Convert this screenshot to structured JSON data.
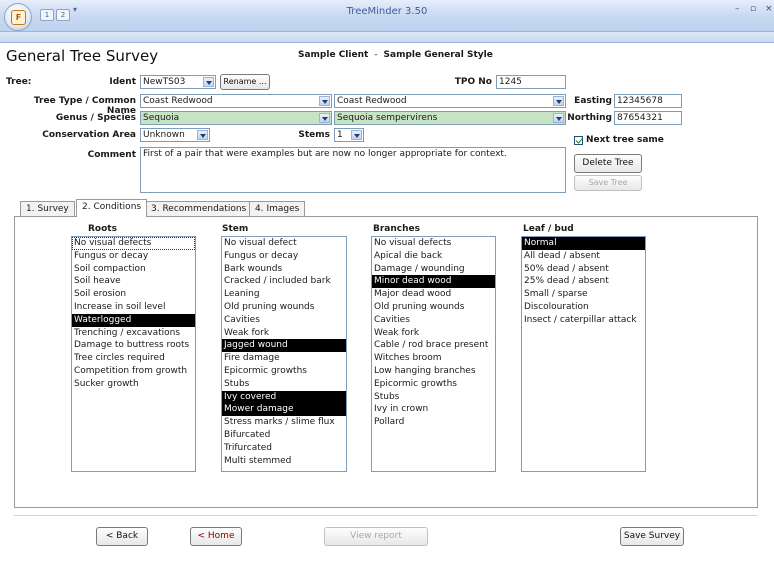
{
  "app": {
    "title": "TreeMinder 3.50",
    "office_button_letter": "F",
    "quick_access": [
      "1",
      "2"
    ]
  },
  "form": {
    "title": "General Tree Survey",
    "client": "Sample Client",
    "separator": "-",
    "style": "Sample General Style"
  },
  "tree": {
    "tree_label": "Tree:",
    "ident_label": "Ident",
    "ident_value": "NewTS03",
    "rename_button": "Rename ...",
    "tpo_label": "TPO No",
    "tpo_value": "1245",
    "type_label": "Tree Type / Common Name",
    "type_value": "Coast Redwood",
    "common_value": "Coast Redwood",
    "genus_label": "Genus / Species",
    "genus_value": "Sequoia",
    "species_value": "Sequoia sempervirens",
    "conservation_label": "Conservation Area",
    "conservation_value": "Unknown",
    "stems_label": "Stems",
    "stems_value": "1",
    "easting_label": "Easting",
    "easting_value": "12345678",
    "northing_label": "Northing",
    "northing_value": "87654321",
    "next_tree_same_label": "Next tree same",
    "next_tree_same_checked": true,
    "comment_label": "Comment",
    "comment_value": "First of a pair that were examples but are now no longer appropriate for context.",
    "delete_button": "Delete Tree",
    "save_tree_button": "Save Tree"
  },
  "tabs": [
    {
      "label": "1.  Survey",
      "active": false
    },
    {
      "label": "2. Conditions",
      "active": true
    },
    {
      "label": "3.  Recommendations",
      "active": false
    },
    {
      "label": "4.  Images",
      "active": false
    }
  ],
  "conditions": {
    "roots": {
      "header": "Roots",
      "items": [
        "No visual defects",
        "Fungus or decay",
        "Soil compaction",
        "Soil heave",
        "Soil erosion",
        "Increase in soil level",
        "Waterlogged",
        "Trenching / excavations",
        "Damage to buttress roots",
        "Tree circles required",
        "Competition from growth",
        "Sucker growth"
      ],
      "selected": [
        6
      ],
      "focused": 0
    },
    "stem": {
      "header": "Stem",
      "items": [
        "No visual defect",
        "Fungus or decay",
        "Bark wounds",
        "Cracked / included bark",
        "Leaning",
        "Old pruning wounds",
        "Cavities",
        "Weak fork",
        "Jagged wound",
        "Fire damage",
        "Epicormic growths",
        "Stubs",
        "Ivy covered",
        "Mower damage",
        "Stress marks / slime flux",
        "Bifurcated",
        "Trifurcated",
        "Multi stemmed"
      ],
      "selected": [
        8,
        12,
        13
      ]
    },
    "branches": {
      "header": "Branches",
      "items": [
        "No visual defects",
        "Apical die back",
        "Damage / wounding",
        "Minor dead wood",
        "Major dead wood",
        "Old pruning wounds",
        "Cavities",
        "Weak fork",
        "Cable / rod brace present",
        "Witches broom",
        "Low hanging branches",
        "Epicormic growths",
        "Stubs",
        "Ivy in crown",
        "Pollard"
      ],
      "selected": [
        3
      ]
    },
    "leaf": {
      "header": "Leaf / bud",
      "items": [
        "Normal",
        "All dead / absent",
        "50% dead / absent",
        "25% dead / absent",
        "Small / sparse",
        "Discolouration",
        "Insect / caterpillar attack"
      ],
      "selected": [
        0
      ]
    }
  },
  "footer": {
    "back_button": "< Back",
    "home_button": "< Home",
    "view_report_button": "View report",
    "save_survey_button": "Save Survey"
  },
  "colors": {
    "field_green": "#c6e3c4",
    "title_blue": "#3e5d99",
    "selection": "#000000"
  }
}
